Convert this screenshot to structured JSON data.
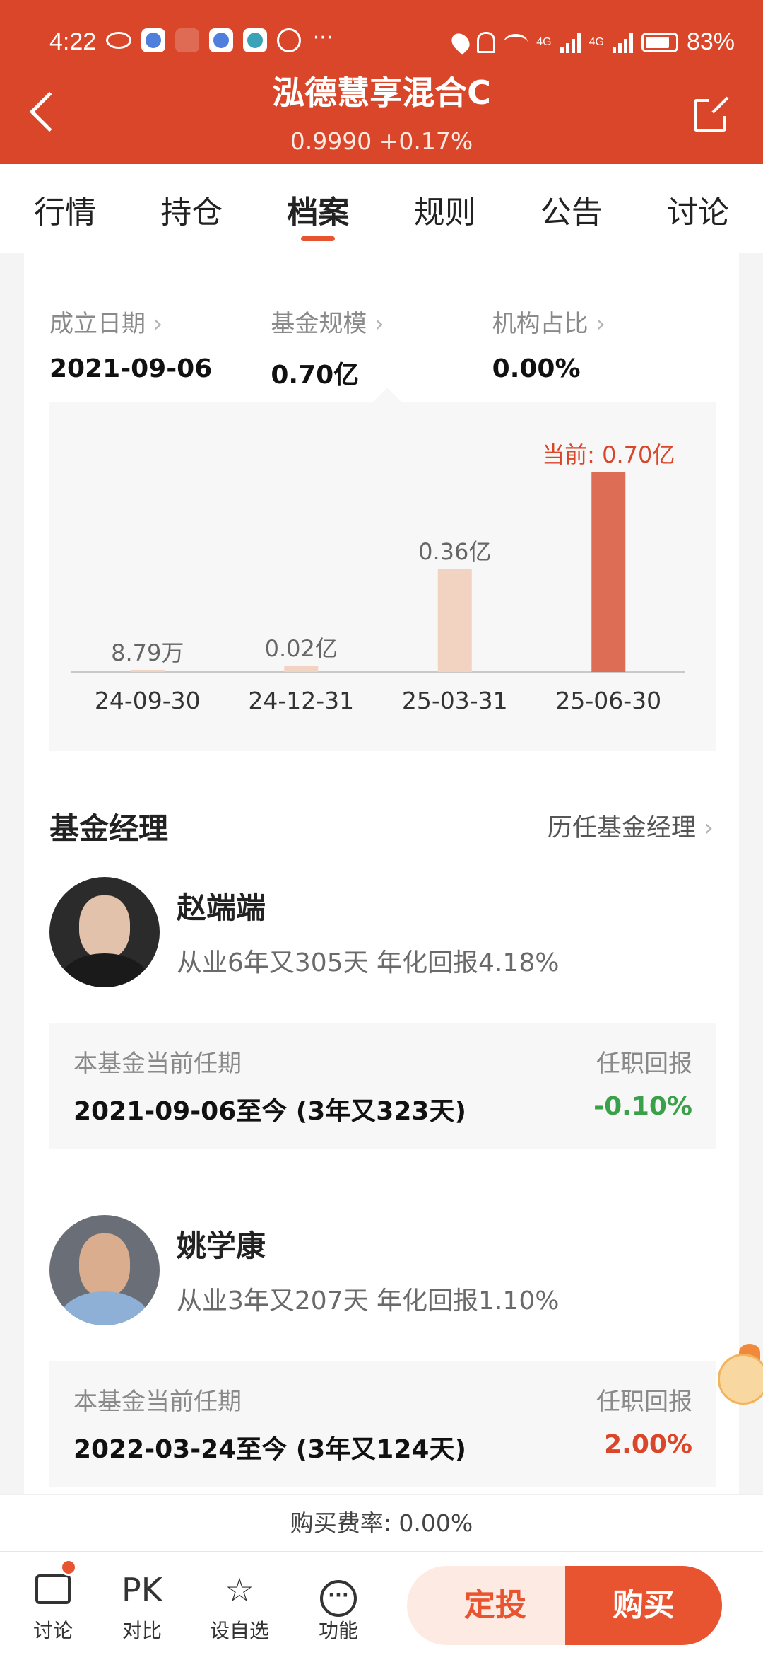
{
  "status_bar": {
    "time": "4:22",
    "more": "···",
    "net1": "4G",
    "net2": "4G",
    "battery": "83%"
  },
  "header": {
    "title": "泓德慧享混合C",
    "subtitle": "0.9990 +0.17%"
  },
  "tabs": [
    "行情",
    "持仓",
    "档案",
    "规则",
    "公告",
    "讨论"
  ],
  "active_tab": "档案",
  "stats": [
    {
      "label": "成立日期",
      "value": "2021-09-06"
    },
    {
      "label": "基金规模",
      "value": "0.70亿"
    },
    {
      "label": "机构占比",
      "value": "0.00%"
    }
  ],
  "chart_data": {
    "type": "bar",
    "categories": [
      "24-09-30",
      "24-12-31",
      "25-03-31",
      "25-06-30"
    ],
    "values": [
      0.000879,
      0.02,
      0.36,
      0.7
    ],
    "unit": "亿",
    "data_labels": [
      "8.79万",
      "0.02亿",
      "0.36亿",
      "当前: 0.70亿"
    ],
    "ylim": [
      0,
      0.7
    ],
    "colors": [
      "#f2d3c1",
      "#f2d3c1",
      "#f2d3c1",
      "#dd6e55"
    ],
    "label_colors": [
      "#666666",
      "#666666",
      "#666666",
      "#d9462a"
    ]
  },
  "managers_section": {
    "title": "基金经理",
    "link": "历任基金经理"
  },
  "managers": [
    {
      "name": "赵端端",
      "desc": "从业6年又305天 年化回报4.18%",
      "term_label": "本基金当前任期",
      "term_value": "2021-09-06至今 (3年又323天)",
      "return_label": "任职回报",
      "return_value": "-0.10%",
      "return_color": "#3aa04a"
    },
    {
      "name": "姚学康",
      "desc": "从业3年又207天 年化回报1.10%",
      "term_label": "本基金当前任期",
      "term_value": "2022-03-24至今 (3年又124天)",
      "return_label": "任职回报",
      "return_value": "2.00%",
      "return_color": "#d9462a"
    }
  ],
  "fee_text": "购买费率: 0.00%",
  "bottom_bar": {
    "items": [
      {
        "label": "讨论",
        "icon": "chat-icon"
      },
      {
        "label": "对比",
        "icon_text": "PK"
      },
      {
        "label": "设自选",
        "icon": "star-icon"
      },
      {
        "label": "功能",
        "icon": "more-icon"
      }
    ],
    "sip_label": "定投",
    "buy_label": "购买"
  }
}
